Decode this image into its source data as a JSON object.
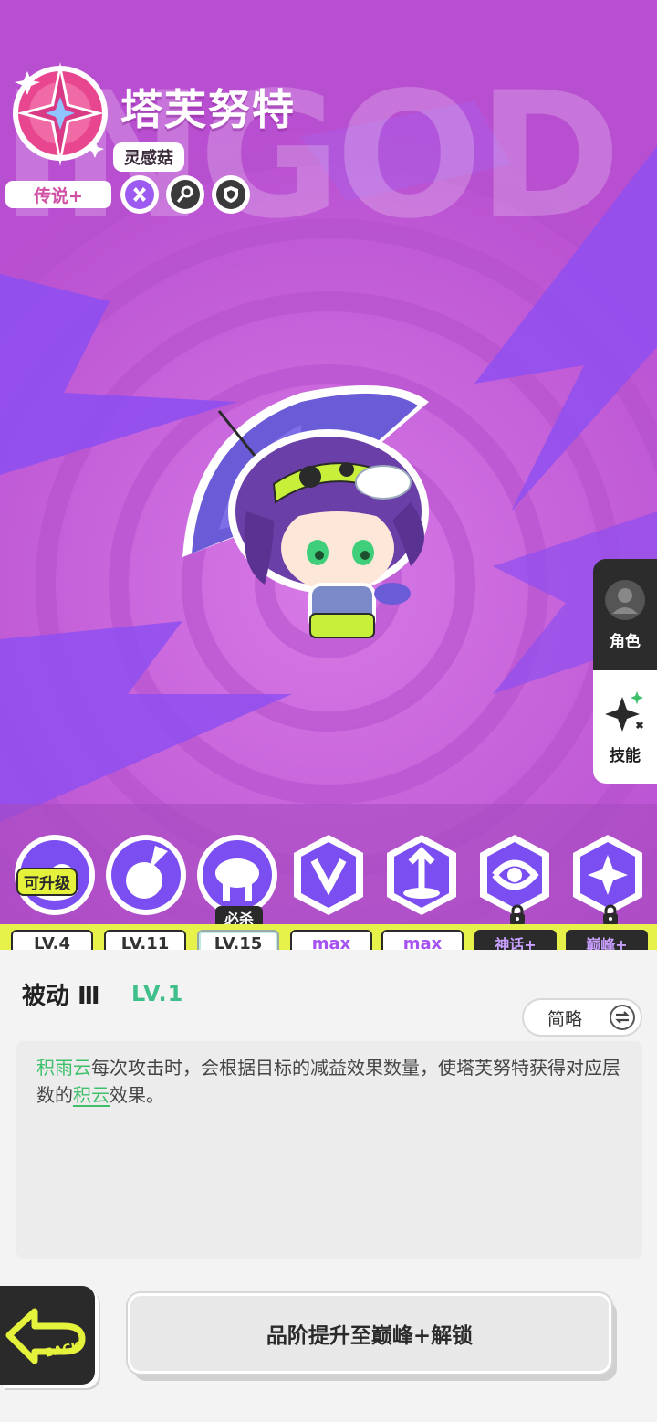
{
  "character": {
    "name": "塔芙努特",
    "faction": "灵感菇",
    "rarity": "传说+",
    "bg_word": "INGOD",
    "traits": [
      "x-icon",
      "key-icon",
      "shield-icon"
    ]
  },
  "side_tabs": {
    "role_label": "角色",
    "skill_label": "技能"
  },
  "skills": {
    "upgradable_badge": "可升级",
    "ultimate_badge": "必杀",
    "levels": [
      "LV.4",
      "LV.11",
      "LV.15",
      "max",
      "max",
      "神话+",
      "巅峰+"
    ]
  },
  "detail": {
    "title": "被动 Ⅲ",
    "level": "LV.1",
    "brief_label": "简略",
    "desc_kw1": "积雨云",
    "desc_text1": "每次攻击时，会根据目标的减益效果数量，使塔芙努特获得对应层数的",
    "desc_kw2": "积云",
    "desc_text2": "效果。"
  },
  "footer": {
    "back_label": "BACK",
    "unlock_label": "品阶提升至巅峰+解锁"
  },
  "colors": {
    "hero_bg": "#c45fd6",
    "accent_yellow": "#e6f24a",
    "keyword_green": "#3fbf6a",
    "max_purple": "#a552f0"
  }
}
